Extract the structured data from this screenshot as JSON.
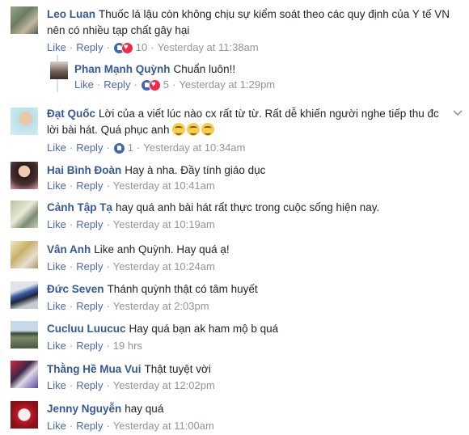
{
  "actions": {
    "like": "Like",
    "reply": "Reply",
    "sep": "·"
  },
  "comments": [
    {
      "name": "Leo Luan",
      "text": "Thuốc lá lậu còn không chịu sự kiểm soát theo các quy định của Y tế VN nên có nhiều tạp chất gây hại",
      "reactions": "10",
      "time": "Yesterday at 11:38am"
    },
    {
      "name": "Phan Mạnh Quỳnh",
      "text": "Chuẩn luôn!!",
      "reactions": "5",
      "time": "Yesterday at 1:29pm"
    },
    {
      "name": "Đạt Quốc",
      "text": "Lời của a viết lúc nào cx rất từ từ. Rất dễ khiến người nghe tiếp thu đc lời bài hát. Quá phục anh",
      "reactions": "1",
      "time": "Yesterday at 10:34am"
    },
    {
      "name": "Hai Bình Đoàn",
      "text": "Hay à nha. Đầy tính giáo dục",
      "time": "Yesterday at 10:41am"
    },
    {
      "name": "Cảnh Tập Tạ",
      "text": "hay quá anh bài hát rất thực trong cuộc sống hiện nay.",
      "time": "Yesterday at 10:19am"
    },
    {
      "name": "Vân Anh",
      "text": "Like anh Quỳnh. Hay quá ạ!",
      "time": "Yesterday at 10:24am"
    },
    {
      "name": "Đức Seven",
      "text": "Thánh quỳnh thật có tâm huyết",
      "time": "Yesterday at 2:03pm"
    },
    {
      "name": "Cucluu Luucuc",
      "text": "Hay quá bạn ak ham mộ b quá",
      "time": "19 hrs"
    },
    {
      "name": "Thằng Hề Mua Vui",
      "text": "Thật tuyệt vời",
      "time": "Yesterday at 12:02pm"
    },
    {
      "name": "Jenny Nguyễn",
      "text": "hay quá",
      "time": "Yesterday at 11:00am"
    }
  ],
  "icons": {
    "options": "chevron-down-icon",
    "reaction_like": "like-reaction-icon",
    "reaction_love": "love-reaction-icon",
    "emoji": "grinning-emoji-icon"
  },
  "colors": {
    "name": "#365899",
    "link": "#4b6aa8",
    "meta": "#90949c",
    "like": "#4267b2",
    "love": "#f0284a"
  }
}
